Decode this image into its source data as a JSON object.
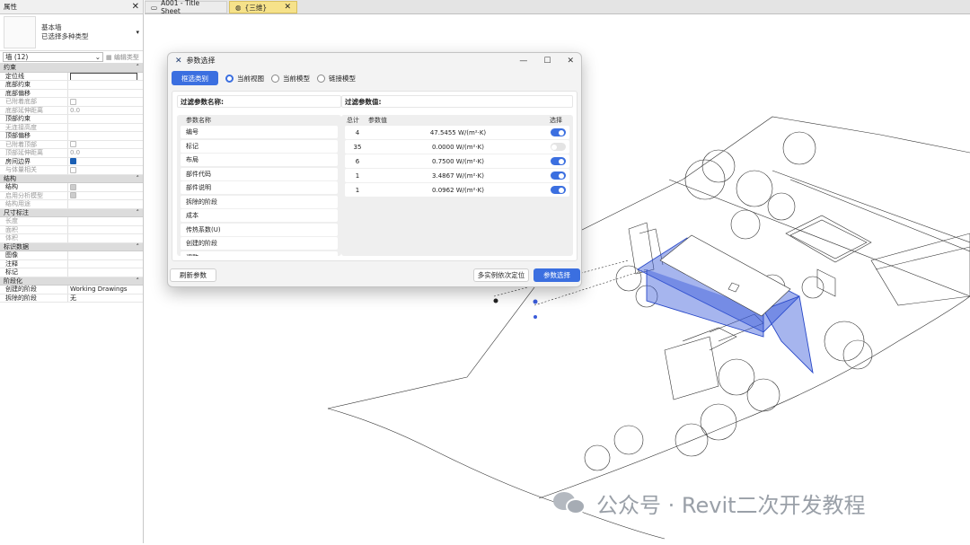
{
  "properties": {
    "title": "属性",
    "type_name": "基本墙",
    "type_sub": "已选择多种类型",
    "selector": "墙 (12)",
    "edit_type": "编辑类型",
    "groups": [
      {
        "name": "约束",
        "rows": [
          {
            "k": "定位线",
            "v": "",
            "kind": "input"
          },
          {
            "k": "底部约束",
            "v": ""
          },
          {
            "k": "底部偏移",
            "v": ""
          },
          {
            "k": "已附着底部",
            "v": "",
            "kind": "cbdis",
            "grey": true
          },
          {
            "k": "底部延伸距离",
            "v": "0.0",
            "grey": true
          },
          {
            "k": "顶部约束",
            "v": ""
          },
          {
            "k": "无连接高度",
            "v": "",
            "grey": true
          },
          {
            "k": "顶部偏移",
            "v": ""
          },
          {
            "k": "已附着顶部",
            "v": "",
            "kind": "cbdis",
            "grey": true
          },
          {
            "k": "顶部延伸距离",
            "v": "0.0",
            "grey": true
          },
          {
            "k": "房间边界",
            "v": "",
            "kind": "cbon"
          },
          {
            "k": "与体量相关",
            "v": "",
            "kind": "cbdis",
            "grey": true
          }
        ]
      },
      {
        "name": "结构",
        "rows": [
          {
            "k": "结构",
            "v": "",
            "kind": "cbgrey"
          },
          {
            "k": "启用分析模型",
            "v": "",
            "kind": "cbgrey",
            "grey": true
          },
          {
            "k": "结构用途",
            "v": "",
            "grey": true
          }
        ]
      },
      {
        "name": "尺寸标注",
        "rows": [
          {
            "k": "长度",
            "v": "",
            "grey": true
          },
          {
            "k": "面积",
            "v": "",
            "grey": true
          },
          {
            "k": "体积",
            "v": "",
            "grey": true
          }
        ]
      },
      {
        "name": "标识数据",
        "rows": [
          {
            "k": "图像",
            "v": ""
          },
          {
            "k": "注释",
            "v": ""
          },
          {
            "k": "标记",
            "v": ""
          }
        ]
      },
      {
        "name": "阶段化",
        "rows": [
          {
            "k": "创建的阶段",
            "v": "Working Drawings"
          },
          {
            "k": "拆除的阶段",
            "v": "无"
          }
        ]
      }
    ]
  },
  "tabs": [
    {
      "label": "A001 - Title Sheet"
    },
    {
      "label": "{三维}"
    }
  ],
  "dialog": {
    "title": "参数选择",
    "filter_category_btn": "框选类别",
    "radios": [
      {
        "label": "当前视图",
        "selected": true
      },
      {
        "label": "当前模型",
        "selected": false
      },
      {
        "label": "链接模型",
        "selected": false
      }
    ],
    "left_title": "过滤参数名称:",
    "right_title": "过滤参数值:",
    "param_header": "参数名称",
    "params": [
      "编号",
      "标记",
      "布局",
      "部件代码",
      "部件说明",
      "拆除的阶段",
      "成本",
      "传热系数(U)",
      "创建的阶段",
      "调整"
    ],
    "value_headers": {
      "total": "总计",
      "value": "参数值",
      "select": "选择"
    },
    "values": [
      {
        "total": "4",
        "value": "47.5455 W/(m²·K)",
        "on": true
      },
      {
        "total": "35",
        "value": "0.0000 W/(m²·K)",
        "on": false
      },
      {
        "total": "6",
        "value": "0.7500 W/(m²·K)",
        "on": true
      },
      {
        "total": "1",
        "value": "3.4867 W/(m²·K)",
        "on": true
      },
      {
        "total": "1",
        "value": "0.0962 W/(m²·K)",
        "on": true
      }
    ],
    "refresh_btn": "刷新参数",
    "locate_btn": "多实例依次定位",
    "select_btn": "参数选择"
  },
  "watermark": "公众号 · Revit二次开发教程",
  "colors": {
    "accent": "#3b6fe0",
    "selection_blue": "#3a5bd9"
  }
}
